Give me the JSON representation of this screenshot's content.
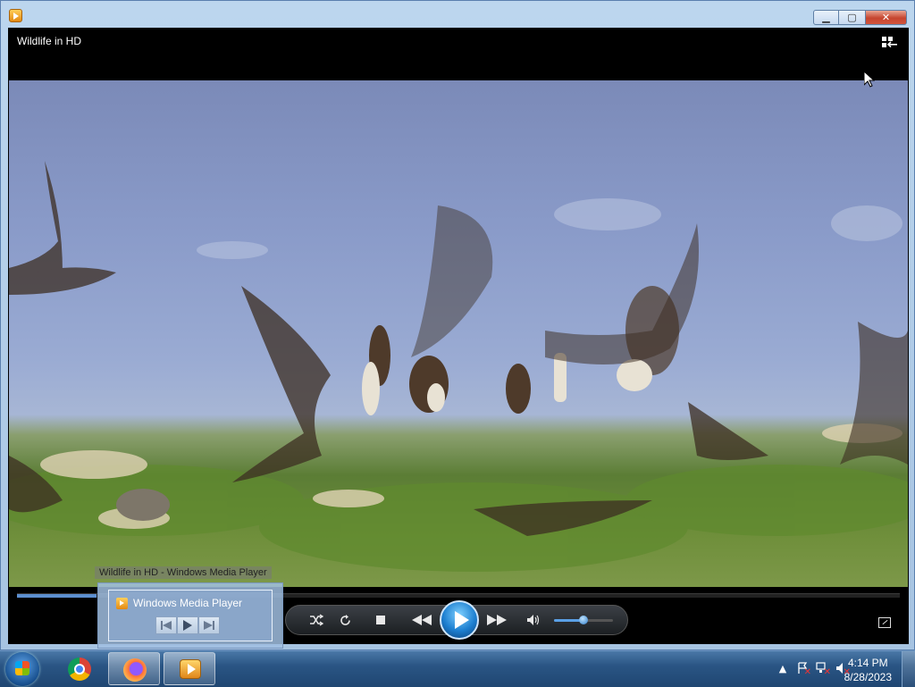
{
  "window": {
    "title": "Wildlife in HD",
    "buttons": {
      "minimize": "▁",
      "maximize": "▢",
      "close": "✕"
    }
  },
  "player": {
    "seek_progress_percent": 9,
    "volume_percent": 50,
    "controls": [
      "shuffle",
      "repeat",
      "stop",
      "previous",
      "play",
      "next",
      "mute",
      "volume",
      "fullscreen"
    ]
  },
  "thumbnail": {
    "caption": "Wildlife in HD - Windows Media Player",
    "title": "Windows Media Player"
  },
  "taskbar": {
    "clock_time": "4:14 PM",
    "clock_date": "8/28/2023",
    "tray_expand": "▲"
  },
  "colors": {
    "accent": "#1d7fd0",
    "taskbar": "#2a5584",
    "close": "#c6452f"
  }
}
